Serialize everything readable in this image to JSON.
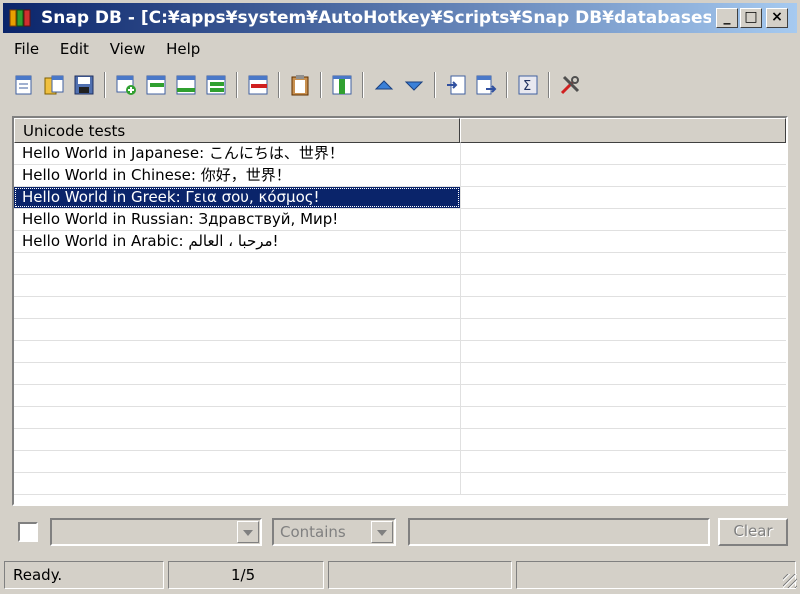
{
  "window": {
    "title": "Snap DB - [C:¥apps¥system¥AutoHotkey¥Scripts¥Snap DB¥databases¥U...",
    "minimize": "_",
    "maximize": "□",
    "close": "×"
  },
  "menu": {
    "file": "File",
    "edit": "Edit",
    "view": "View",
    "help": "Help"
  },
  "toolbar": {
    "icons": [
      "new-db-icon",
      "open-db-icon",
      "save-db-icon",
      "add-row-icon",
      "insert-row-icon",
      "append-row-icon",
      "duplicate-row-icon",
      "delete-row-icon",
      "paste-icon",
      "column-icon",
      "move-up-icon",
      "move-down-icon",
      "import-icon",
      "export-icon",
      "sum-icon",
      "settings-icon"
    ]
  },
  "list": {
    "columns": [
      "Unicode tests",
      ""
    ],
    "rows": [
      {
        "c1": "Hello World in Japanese: こんにちは、世界！",
        "c2": ""
      },
      {
        "c1": "Hello World in Chinese: 你好，世界！",
        "c2": ""
      },
      {
        "c1": "Hello World in Greek: Γεια σου, κόσμος!",
        "c2": ""
      },
      {
        "c1": "Hello World in Russian: Здравствуй, Мир!",
        "c2": ""
      },
      {
        "c1": "Hello World in Arabic: مرحبا ، العالم!",
        "c2": ""
      }
    ],
    "selected_index": 2
  },
  "filter": {
    "field_value": "",
    "operator_value": "Contains",
    "query_value": "",
    "clear_label": "Clear"
  },
  "status": {
    "text": "Ready.",
    "position": "1/5",
    "panel3": "",
    "panel4": ""
  },
  "colors": {
    "selection": "#0a246a",
    "titlebar_start": "#0a246a",
    "titlebar_end": "#a6caf0"
  }
}
